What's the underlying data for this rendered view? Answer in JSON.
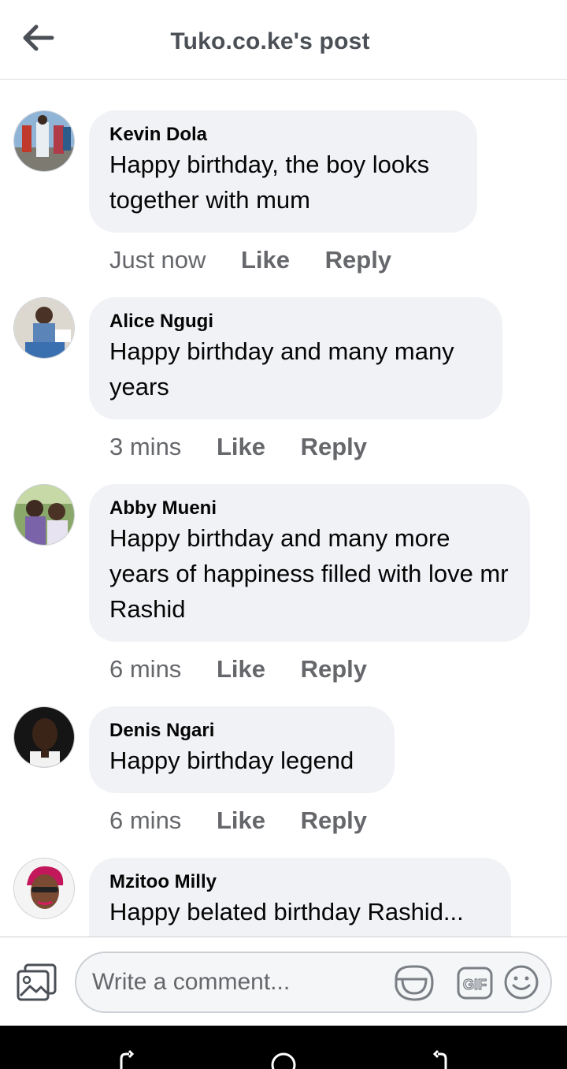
{
  "header": {
    "title": "Tuko.co.ke's post",
    "back_icon": "arrow-left-icon"
  },
  "comments": [
    {
      "author": "Kevin Dola",
      "text": "Happy birthday, the boy looks together with mum",
      "time": "Just now",
      "like": "Like",
      "reply": "Reply"
    },
    {
      "author": "Alice Ngugi",
      "text": "Happy birthday and many many years",
      "time": "3 mins",
      "like": "Like",
      "reply": "Reply"
    },
    {
      "author": "Abby Mueni",
      "text": "Happy birthday and many more years of happiness filled with love mr Rashid",
      "time": "6 mins",
      "like": "Like",
      "reply": "Reply"
    },
    {
      "author": "Denis Ngari",
      "text": "Happy birthday legend",
      "time": "6 mins",
      "like": "Like",
      "reply": "Reply"
    },
    {
      "author": "Mzitoo Milly",
      "text": "Happy belated birthday Rashid..."
    }
  ],
  "composer": {
    "placeholder": "Write a comment...",
    "icons": [
      "photo-icon",
      "sticker-icon",
      "gif-icon",
      "emoji-icon"
    ]
  },
  "system_nav": {
    "icons": [
      "recent-apps-icon",
      "home-icon",
      "back-icon"
    ]
  },
  "colors": {
    "bubble": "#f0f2f5",
    "secondary_text": "#65676b",
    "title_text": "#4b4f56",
    "nav_bar": "#000000"
  }
}
